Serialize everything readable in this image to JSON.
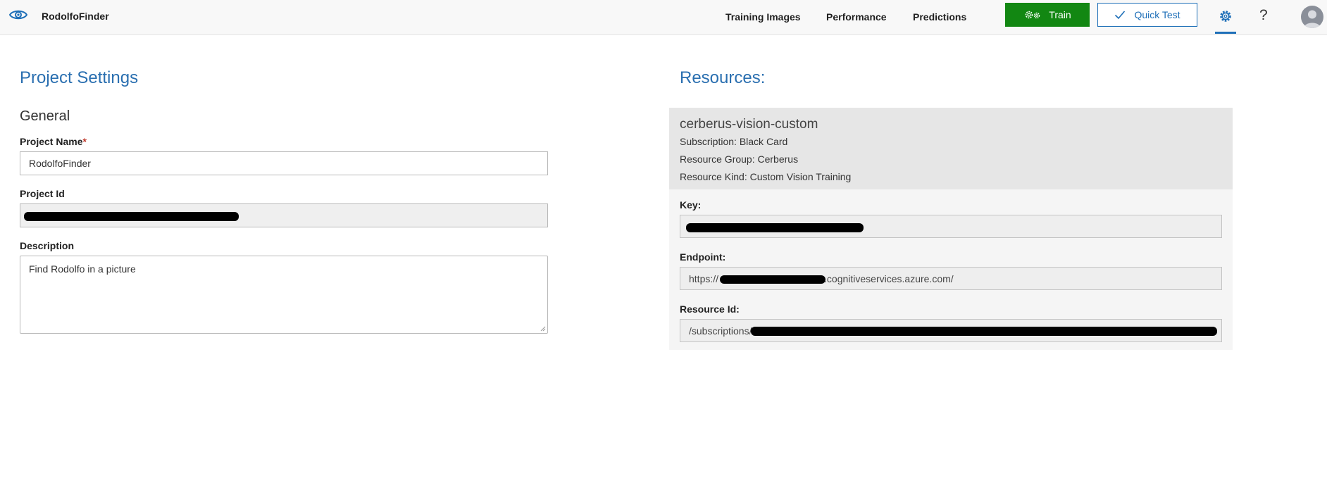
{
  "app": {
    "title": "RodolfoFinder"
  },
  "nav": {
    "training_images": "Training Images",
    "performance": "Performance",
    "predictions": "Predictions"
  },
  "actions": {
    "train_label": "Train",
    "quick_test_label": "Quick Test",
    "help_label": "?"
  },
  "colors": {
    "accent": "#1e6fb8",
    "train_green": "#128712"
  },
  "project_settings": {
    "title": "Project Settings",
    "section": "General",
    "project_name_label": "Project Name",
    "required_marker": "*",
    "project_name_value": "RodolfoFinder",
    "project_id_label": "Project Id",
    "project_id_value": "",
    "description_label": "Description",
    "description_value": "Find Rodolfo in a picture"
  },
  "resources": {
    "title": "Resources:",
    "name": "cerberus-vision-custom",
    "subscription_line": "Subscription:  Black Card",
    "resource_group_line": "Resource Group:  Cerberus",
    "resource_kind_line": "Resource Kind:  Custom Vision Training",
    "key_label": "Key:",
    "key_value": "",
    "endpoint_label": "Endpoint:",
    "endpoint_prefix": "https://",
    "endpoint_suffix": ".cognitiveservices.azure.com/",
    "resource_id_label": "Resource Id:",
    "resource_id_prefix": "/subscriptions/"
  }
}
